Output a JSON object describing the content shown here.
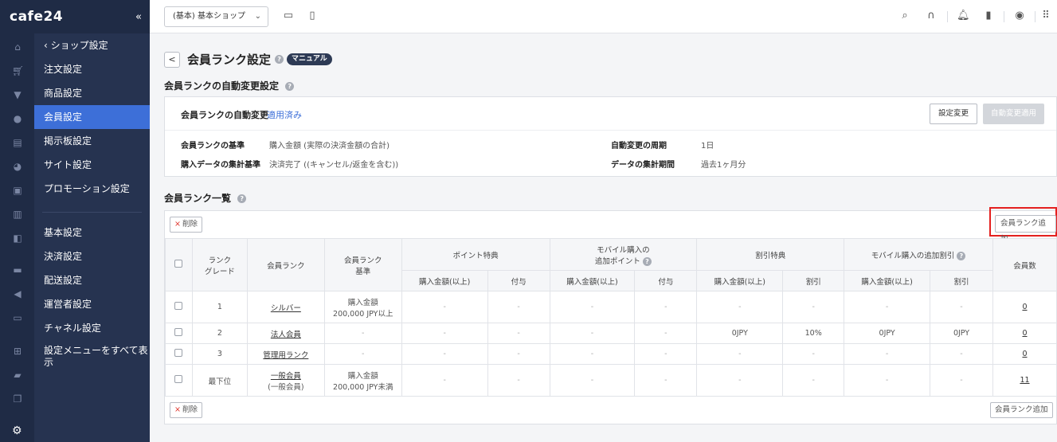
{
  "logo": "cafe24",
  "sidebar": {
    "collapse_icon": "double-chevron-left-icon",
    "back_item": "‹ ショップ設定",
    "items": [
      {
        "label": "注文設定"
      },
      {
        "label": "商品設定"
      },
      {
        "label": "会員設定",
        "active": true
      },
      {
        "label": "掲示板設定"
      },
      {
        "label": "サイト設定"
      },
      {
        "label": "プロモーション設定"
      }
    ],
    "items2": [
      {
        "label": "基本設定"
      },
      {
        "label": "決済設定"
      },
      {
        "label": "配送設定"
      },
      {
        "label": "運営者設定"
      },
      {
        "label": "チャネル設定"
      },
      {
        "label": "設定メニューをすべて表示"
      }
    ],
    "rail_icons": [
      "home-icon",
      "cart-icon",
      "shirt-icon",
      "person-icon",
      "board-icon",
      "palette-icon",
      "ad-icon",
      "chart-icon",
      "app-icon",
      "bag-icon",
      "megaphone-icon",
      "store-icon",
      "grid-plus-icon",
      "folder-icon",
      "copy-icon",
      "gear-icon"
    ]
  },
  "topbar": {
    "shop_select": "(基本) 基本ショップ",
    "icons": [
      "desktop-icon",
      "mobile-icon",
      "search-icon",
      "headset-icon",
      "bell-icon",
      "bookmark-icon",
      "user-icon",
      "apps-grid-icon"
    ]
  },
  "page": {
    "title": "会員ランク設定",
    "manual": "マニュアル",
    "section1_title": "会員ランクの自動変更設定",
    "auto_change_label": "会員ランクの自動変更",
    "auto_change_status": "適用済み",
    "btn_setting_change": "設定変更",
    "btn_auto_apply": "自動変更適用",
    "basis_label": "会員ランクの基準",
    "basis_value": "購入金額 (実際の決済金額の合計)",
    "aggregation_label": "購入データの集計基準",
    "aggregation_value": "決済完了 ((キャンセル/返金を含む))",
    "cycle_label": "自動変更の周期",
    "cycle_value": "1日",
    "period_label": "データの集計期間",
    "period_value": "過去1ヶ月分",
    "section2_title": "会員ランク一覧",
    "btn_delete": "削除",
    "btn_add_rank": "会員ランク追加"
  },
  "table": {
    "headers": {
      "rank_grade": "ランク\nグレード",
      "rank_name": "会員ランク",
      "rank_basis": "会員ランク\n基準",
      "point": "ポイント特典",
      "mobile_point": "モバイル購入の\n追加ポイント",
      "discount": "割引特典",
      "mobile_discount": "モバイル購入の追加割引",
      "member_count": "会員数",
      "purchase_min": "購入金額(以上)",
      "grant": "付与",
      "discount_sub": "割引"
    },
    "rows": [
      {
        "grade": "1",
        "name": "シルバー",
        "name2": "",
        "basis1": "購入金額",
        "basis2": "200,000 JPY以上",
        "c1": "-",
        "c2": "-",
        "c3": "-",
        "c4": "-",
        "c5": "-",
        "c6": "-",
        "c7": "-",
        "c8": "-",
        "count": "0"
      },
      {
        "grade": "2",
        "name": "法人会員",
        "name2": "",
        "basis1": "-",
        "basis2": "",
        "c1": "-",
        "c2": "-",
        "c3": "-",
        "c4": "-",
        "c5": "0JPY",
        "c6": "10%",
        "c7": "0JPY",
        "c8": "0JPY",
        "count": "0"
      },
      {
        "grade": "3",
        "name": "管理用ランク",
        "name2": "",
        "basis1": "-",
        "basis2": "",
        "c1": "-",
        "c2": "-",
        "c3": "-",
        "c4": "-",
        "c5": "-",
        "c6": "-",
        "c7": "-",
        "c8": "-",
        "count": "0"
      },
      {
        "grade": "最下位",
        "name": "一般会員",
        "name2": "(一般会員)",
        "basis1": "購入金額",
        "basis2": "200,000 JPY未満",
        "c1": "-",
        "c2": "-",
        "c3": "-",
        "c4": "-",
        "c5": "-",
        "c6": "-",
        "c7": "-",
        "c8": "-",
        "count": "11"
      }
    ]
  },
  "colors": {
    "sidebar_bg": "#263350",
    "active_item": "#3d6fd8",
    "highlight": "#e4201f"
  }
}
